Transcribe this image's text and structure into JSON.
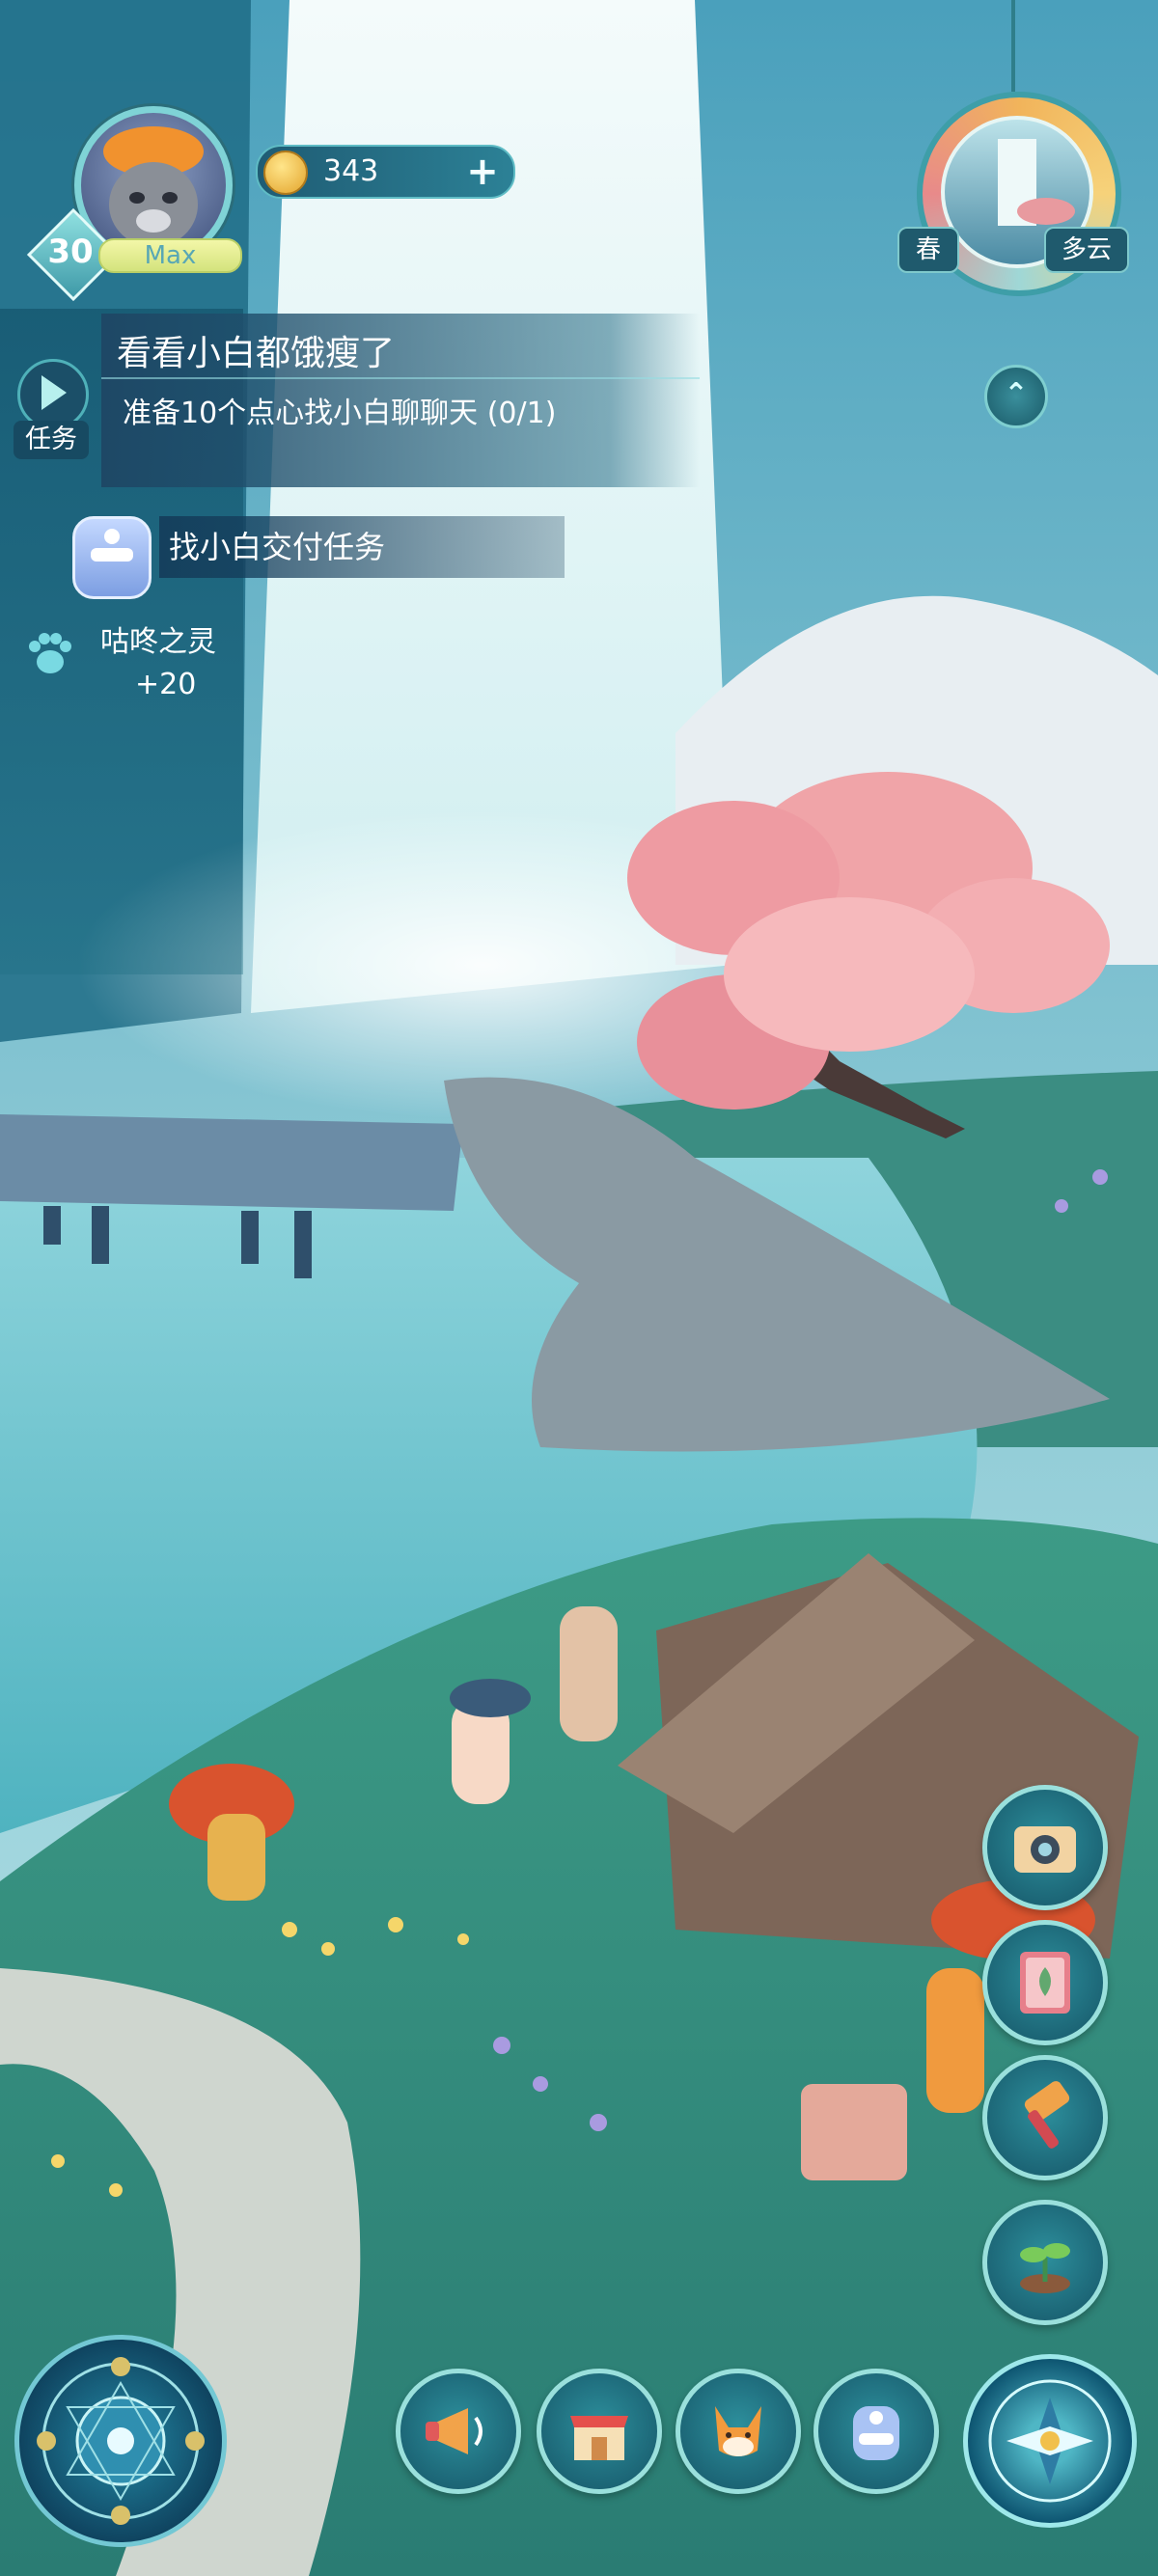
{
  "player": {
    "level": "30",
    "name": "Max"
  },
  "currency": {
    "coins": "343",
    "add_label": "+"
  },
  "environment": {
    "season": "春",
    "weather": "多云"
  },
  "task": {
    "tab_label": "任务",
    "title": "看看小白都饿瘦了",
    "description": "准备10个点心找小白聊聊天 (0/1)",
    "deliver_hint": "找小白交付任务",
    "reward_name": "咕咚之灵",
    "reward_amount": "+20"
  },
  "side_buttons": [
    "camera-icon",
    "album-icon",
    "hammer-icon",
    "sprout-icon"
  ],
  "bottom_buttons": [
    "megaphone-icon",
    "shop-icon",
    "fox-icon",
    "backpack-icon"
  ],
  "colors": {
    "accent": "#2d8f9c",
    "ring": "#9ae0dc",
    "panel": "#1b4f68",
    "coin": "#f1c04b"
  }
}
